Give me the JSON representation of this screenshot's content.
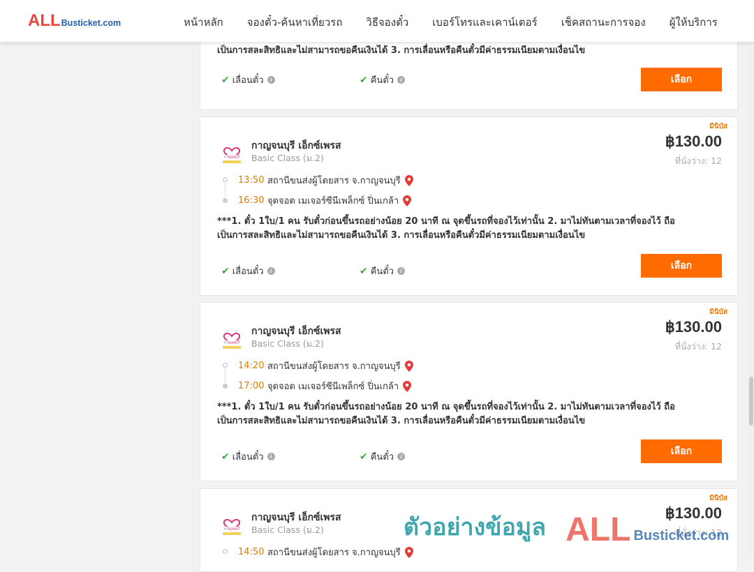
{
  "header": {
    "logo_all": "ALL",
    "logo_site": "Busticket.com",
    "nav": [
      "หน้าหลัก",
      "จองตั๋ว-ค้นหาเที่ยวรถ",
      "วิธีจองตั๋ว",
      "เบอร์โทรและเคาน์เตอร์",
      "เช็คสถานะการจอง",
      "ผู้ให้บริการ"
    ]
  },
  "partial_card": {
    "note_line2": "เป็นการสละสิทธิและไม่สามารถขอคืนเงินได้ 3. การเลื่อนหรือคืนตั๋วมีค่าธรรมเนียมตามเงื่อนไข",
    "opt_change": "เลื่อนตั๋ว",
    "opt_refund": "คืนตั๋ว",
    "button": "เลือก"
  },
  "cards": [
    {
      "badge": "มินิบัส",
      "operator": "กาญจนบุรี เอ็กซ์เพรส",
      "class": "Basic Class (ม.2)",
      "price": "฿130.00",
      "seats": "ที่นั่งว่าง: 12",
      "depart_time": "13:50",
      "depart_place": "สถานีขนส่งผู้โดยสาร จ.กาญจนบุรี",
      "arrive_time": "16:30",
      "arrive_place": "จุดจอด เมเจอร์ซีนีเพล็กซ์ ปิ่นเกล้า",
      "note_line1": "***1. ตั๋ว 1ใบ/1 คน รับตั๋วก่อนขึ้นรถอย่างน้อย 20 นาที ณ จุดขึ้นรถที่จองไว้เท่านั้น 2. มาไม่ทันตามเวลาที่จองไว้ ถือ",
      "note_line2": "เป็นการสละสิทธิและไม่สามารถขอคืนเงินได้ 3. การเลื่อนหรือคืนตั๋วมีค่าธรรมเนียมตามเงื่อนไข",
      "opt_change": "เลื่อนตั๋ว",
      "opt_refund": "คืนตั๋ว",
      "button": "เลือก"
    },
    {
      "badge": "มินิบัส",
      "operator": "กาญจนบุรี เอ็กซ์เพรส",
      "class": "Basic Class (ม.2)",
      "price": "฿130.00",
      "seats": "ที่นั่งว่าง: 12",
      "depart_time": "14:20",
      "depart_place": "สถานีขนส่งผู้โดยสาร จ.กาญจนบุรี",
      "arrive_time": "17:00",
      "arrive_place": "จุดจอด เมเจอร์ซีนีเพล็กซ์ ปิ่นเกล้า",
      "note_line1": "***1. ตั๋ว 1ใบ/1 คน รับตั๋วก่อนขึ้นรถอย่างน้อย 20 นาที ณ จุดขึ้นรถที่จองไว้เท่านั้น 2. มาไม่ทันตามเวลาที่จองไว้ ถือ",
      "note_line2": "เป็นการสละสิทธิและไม่สามารถขอคืนเงินได้ 3. การเลื่อนหรือคืนตั๋วมีค่าธรรมเนียมตามเงื่อนไข",
      "opt_change": "เลื่อนตั๋ว",
      "opt_refund": "คืนตั๋ว",
      "button": "เลือก"
    },
    {
      "badge": "มินิบัส",
      "operator": "กาญจนบุรี เอ็กซ์เพรส",
      "class": "Basic Class (ม.2)",
      "price": "฿130.00",
      "seats": "ที่นั่งว่าง: 12",
      "depart_time": "14:50",
      "depart_place": "สถานีขนส่งผู้โดยสาร จ.กาญจนบุรี"
    }
  ],
  "watermark": {
    "text": "ตัวอย่างข้อมูล",
    "all": "ALL",
    "site": "Busticket.com"
  },
  "colors": {
    "accent": "#ff6b00",
    "time": "#e07b00",
    "check": "#3aa845",
    "logo_red": "#e8483b",
    "logo_blue": "#1d5fa8"
  }
}
